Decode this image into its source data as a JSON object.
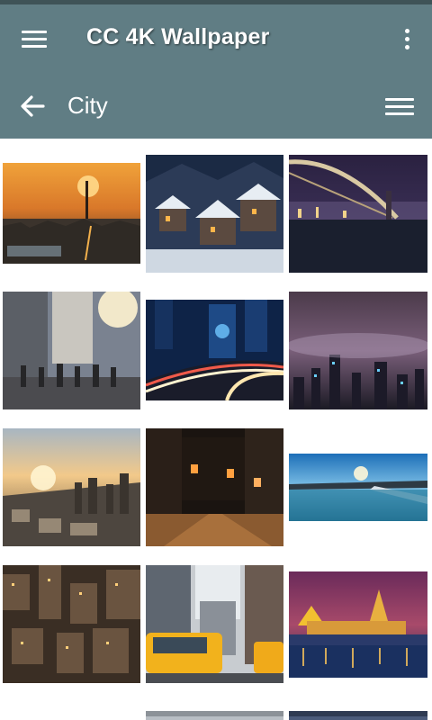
{
  "app": {
    "title": "CC 4K Wallpaper"
  },
  "subheader": {
    "title": "City"
  },
  "icons": {
    "menu": "hamburger-menu-icon",
    "overflow": "vertical-dots-icon",
    "back": "arrow-left-icon",
    "list": "list-icon"
  },
  "colors": {
    "toolbar": "#607d84",
    "status_strip": "#3f5357",
    "background": "#ffffff"
  },
  "wallpapers": [
    {
      "subject": "sunset skyline with tower"
    },
    {
      "subject": "snowy village at night"
    },
    {
      "subject": "illuminated bridge over river at night"
    },
    {
      "subject": "busy street with crowd and sun flare"
    },
    {
      "subject": "highway light trails among skyscrapers"
    },
    {
      "subject": "foggy skyline at night"
    },
    {
      "subject": "aerial city at golden hour"
    },
    {
      "subject": "cobblestone alley at night"
    },
    {
      "subject": "bay panorama with blue sky"
    },
    {
      "subject": "aerial city grid at dusk"
    },
    {
      "subject": "yellow taxis in street canyon"
    },
    {
      "subject": "castle lit at night over river"
    },
    {
      "subject": "partially visible wallpaper"
    },
    {
      "subject": "partially visible wallpaper"
    },
    {
      "subject": "partially visible wallpaper"
    }
  ]
}
